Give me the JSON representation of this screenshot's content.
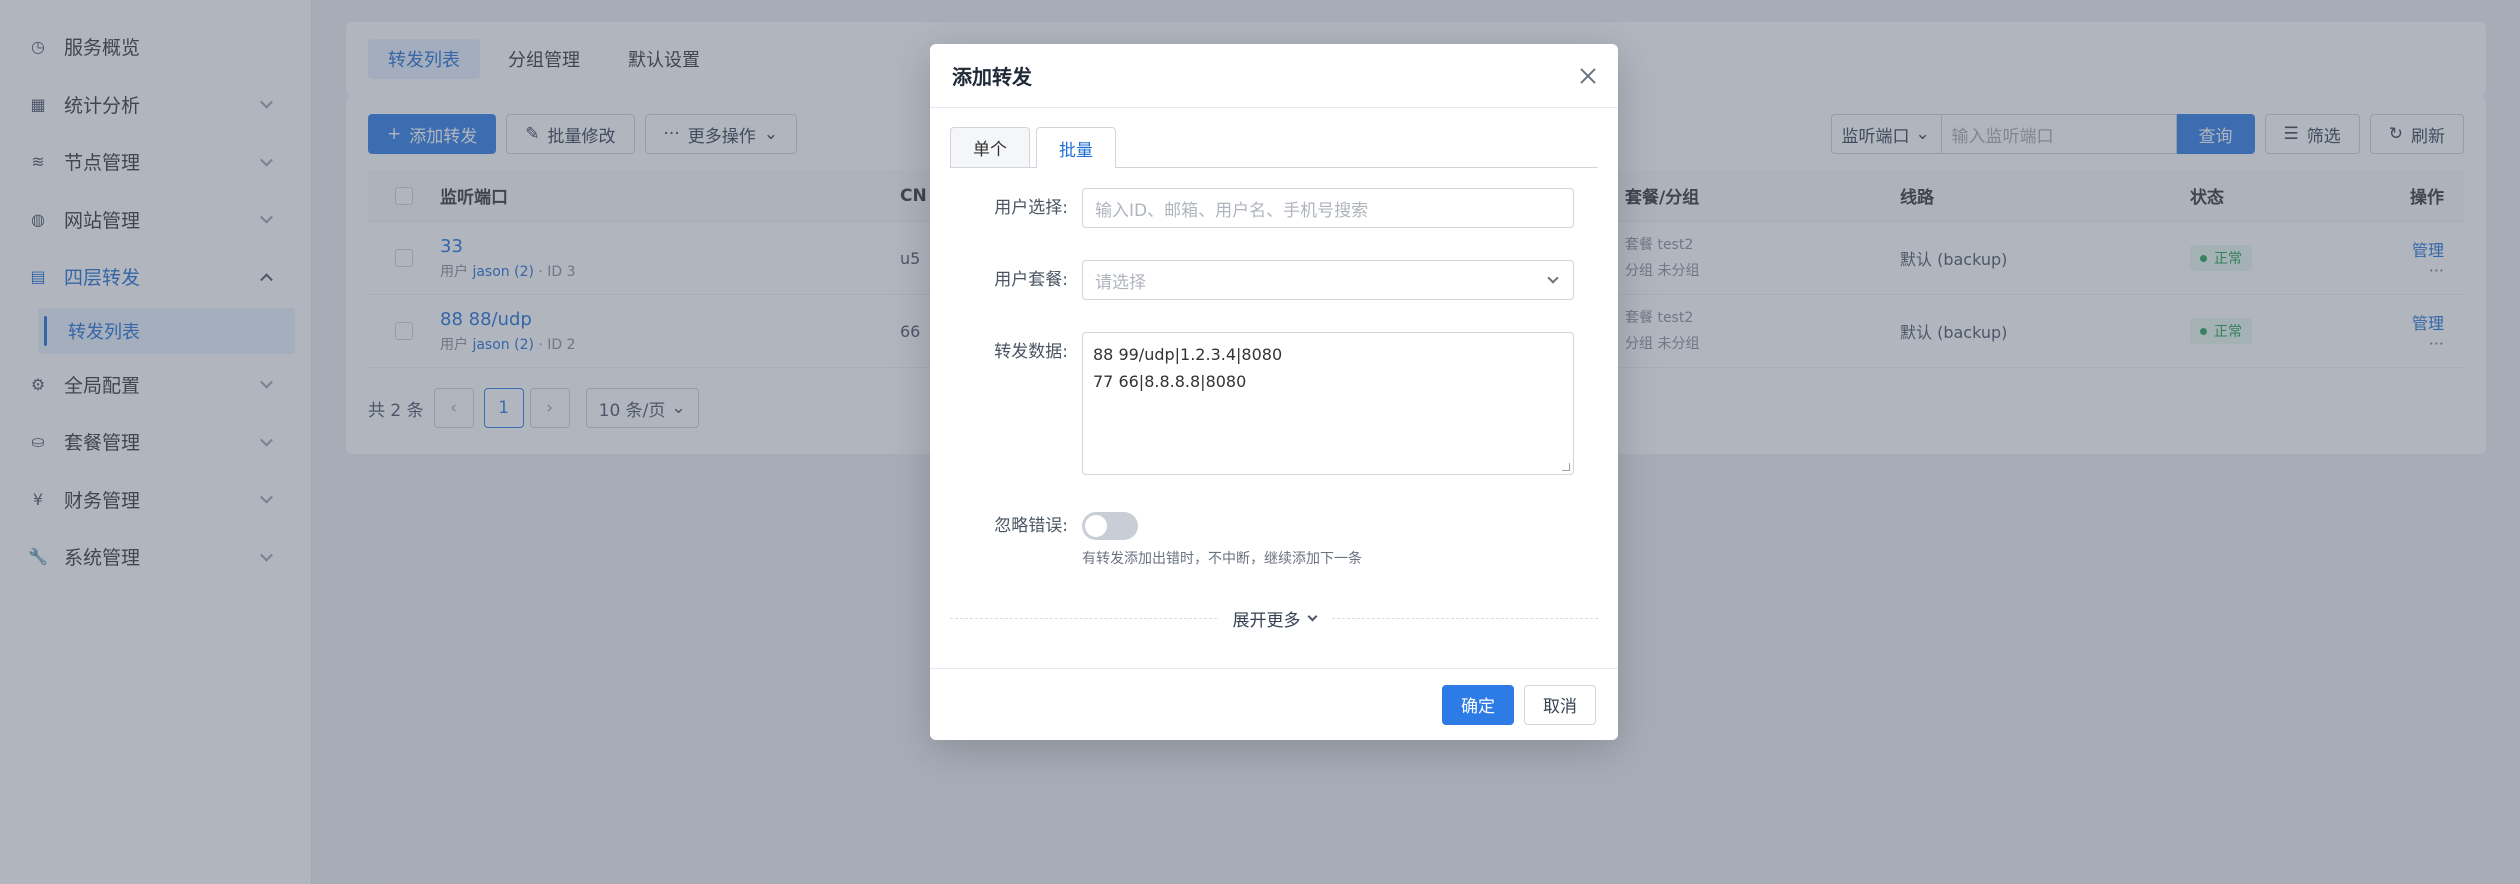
{
  "sidebar": {
    "items": [
      {
        "label": "服务概览",
        "icon": "gauge-icon",
        "glyph": "◷",
        "chevron": false
      },
      {
        "label": "统计分析",
        "icon": "chart-icon",
        "glyph": "▦",
        "chevron": true
      },
      {
        "label": "节点管理",
        "icon": "layers-icon",
        "glyph": "≋",
        "chevron": true
      },
      {
        "label": "网站管理",
        "icon": "globe-icon",
        "glyph": "◍",
        "chevron": true
      },
      {
        "label": "四层转发",
        "icon": "server-icon",
        "glyph": "▤",
        "chevron": true,
        "expanded": true
      },
      {
        "label": "全局配置",
        "icon": "gear-icon",
        "glyph": "⚙",
        "chevron": true
      },
      {
        "label": "套餐管理",
        "icon": "basket-icon",
        "glyph": "⛀",
        "chevron": true
      },
      {
        "label": "财务管理",
        "icon": "yen-icon",
        "glyph": "¥",
        "chevron": true
      },
      {
        "label": "系统管理",
        "icon": "wrench-icon",
        "glyph": "🔧",
        "chevron": true
      }
    ],
    "sub_item": "转发列表"
  },
  "top_tabs": [
    "转发列表",
    "分组管理",
    "默认设置"
  ],
  "toolbar": {
    "add": "添加转发",
    "batch_edit": "批量修改",
    "more": "更多操作",
    "search_field": "监听端口",
    "search_placeholder": "输入监听端口",
    "query": "查询",
    "filter": "筛选",
    "refresh": "刷新"
  },
  "table": {
    "headers": {
      "port": "监听端口",
      "cname": "CN",
      "plan": "套餐/分组",
      "line": "线路",
      "status": "状态",
      "op": "操作"
    },
    "rows": [
      {
        "port": "33",
        "user_prefix": "用户",
        "user": "jason (2)",
        "id": "· ID 3",
        "cname": "u5",
        "plan": "套餐  test2",
        "group": "分组  未分组",
        "line": "默认 (backup)",
        "status": "正常",
        "manage": "管理",
        "more": "···"
      },
      {
        "port": "88 88/udp",
        "user_prefix": "用户",
        "user": "jason (2)",
        "id": "· ID 2",
        "cname": "66",
        "plan": "套餐  test2",
        "group": "分组  未分组",
        "line": "默认 (backup)",
        "status": "正常",
        "manage": "管理",
        "more": "···"
      }
    ]
  },
  "pager": {
    "total": "共 2 条",
    "page": "1",
    "size": "10 条/页"
  },
  "modal": {
    "title": "添加转发",
    "tabs": [
      "单个",
      "批量"
    ],
    "user_label": "用户选择:",
    "user_placeholder": "输入ID、邮箱、用户名、手机号搜索",
    "plan_label": "用户套餐:",
    "plan_placeholder": "请选择",
    "data_label": "转发数据:",
    "data_value": "88 99/udp|1.2.3.4|8080\n77 66|8.8.8.8|8080",
    "ignore_label": "忽略错误:",
    "ignore_hint": "有转发添加出错时，不中断，继续添加下一条",
    "expand": "展开更多",
    "ok": "确定",
    "cancel": "取消"
  },
  "colors": {
    "primary": "#2d7ce6",
    "success": "#22a150"
  }
}
